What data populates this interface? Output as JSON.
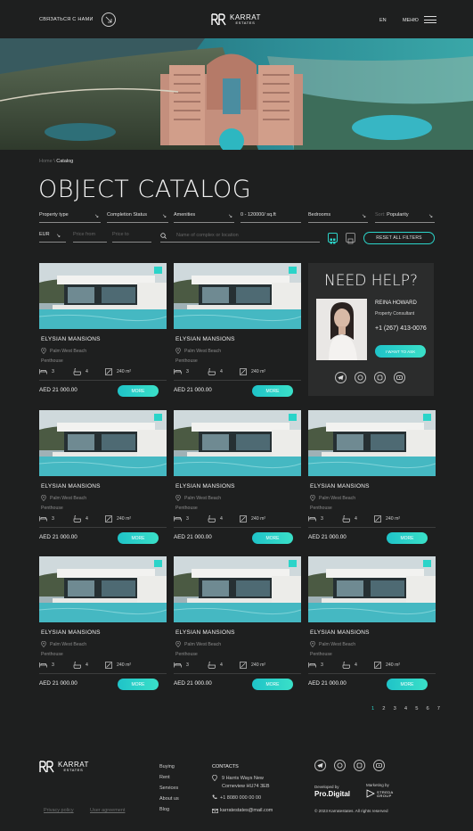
{
  "header": {
    "contact_label": "СВЯЗАТЬСЯ С НАМИ",
    "logo_line1": "KARRAT",
    "logo_line2": "ESTATES",
    "lang": "EN",
    "menu_label": "МЕНЮ"
  },
  "breadcrumb": {
    "home": "Home",
    "separator": "\\",
    "current": "Catalog"
  },
  "page_title": "OBJECT CATALOG",
  "filters": {
    "property_type": "Property type",
    "completion_status": "Completion Status",
    "amenities": "Amenities",
    "price_range": "0 - 120000/ sq.ft",
    "bedrooms": "Bedrooms",
    "sort_prefix": "Sort:",
    "sort_value": "Popularity",
    "currency": "EUR",
    "price_from_placeholder": "Price from",
    "price_to_placeholder": "Price to",
    "search_placeholder": "Name of complex or location",
    "reset_label": "RESET ALL FILTERS"
  },
  "listings": [
    {
      "name": "ELYSIAN MANSIONS",
      "location": "Palm West Beach",
      "type": "Penthouse",
      "bedrooms": "3",
      "baths": "4",
      "area": "240 m²",
      "price": "AED 21 000.00",
      "more_label": "MORE"
    },
    {
      "name": "ELYSIAN MANSIONS",
      "location": "Palm West Beach",
      "type": "Penthouse",
      "bedrooms": "3",
      "baths": "4",
      "area": "240 m²",
      "price": "AED 21 000.00",
      "more_label": "MORE"
    },
    {
      "name": "ELYSIAN MANSIONS",
      "location": "Palm West Beach",
      "type": "Penthouse",
      "bedrooms": "3",
      "baths": "4",
      "area": "240 m²",
      "price": "AED 21 000.00",
      "more_label": "MORE"
    },
    {
      "name": "ELYSIAN MANSIONS",
      "location": "Palm West Beach",
      "type": "Penthouse",
      "bedrooms": "3",
      "baths": "4",
      "area": "240 m²",
      "price": "AED 21 000.00",
      "more_label": "MORE"
    },
    {
      "name": "ELYSIAN MANSIONS",
      "location": "Palm West Beach",
      "type": "Penthouse",
      "bedrooms": "3",
      "baths": "4",
      "area": "240 m²",
      "price": "AED 21 000.00",
      "more_label": "MORE"
    },
    {
      "name": "ELYSIAN MANSIONS",
      "location": "Palm West Beach",
      "type": "Penthouse",
      "bedrooms": "3",
      "baths": "4",
      "area": "240 m²",
      "price": "AED 21 000.00",
      "more_label": "MORE"
    },
    {
      "name": "ELYSIAN MANSIONS",
      "location": "Palm West Beach",
      "type": "Penthouse",
      "bedrooms": "3",
      "baths": "4",
      "area": "240 m²",
      "price": "AED 21 000.00",
      "more_label": "MORE"
    },
    {
      "name": "ELYSIAN MANSIONS",
      "location": "Palm West Beach",
      "type": "Penthouse",
      "bedrooms": "3",
      "baths": "4",
      "area": "240 m²",
      "price": "AED 21 000.00",
      "more_label": "MORE"
    }
  ],
  "help": {
    "title": "NEED HELP?",
    "name": "REINA HOWARD",
    "role": "Property Consultant",
    "phone": "+1 (267) 413-0076",
    "ask_label": "I WANT TO ASK",
    "socials": [
      "telegram-icon",
      "whatsapp-icon",
      "viber-icon",
      "youtube-icon"
    ]
  },
  "pagination": {
    "pages": [
      "1",
      "2",
      "3",
      "4",
      "5",
      "6",
      "7"
    ],
    "current": "1"
  },
  "footer": {
    "logo_line1": "KARRAT",
    "logo_line2": "ESTATES",
    "nav": [
      "Buying",
      "Rent",
      "Services",
      "About us",
      "Blog"
    ],
    "contacts_title": "CONTACTS",
    "address_line1": "9 Harris Ways New",
    "address_line2": "Corneview HU74 3EB",
    "phone": "+1 8080 000 00 00",
    "email": "karratestates@mail.com",
    "privacy": "Privacy policy",
    "agreement": "User agreement",
    "developed_by": "Developed by",
    "developer": "Pro.Digital",
    "marketing_by": "Marketing by",
    "marketer": "STREDA GROUP",
    "copyright": "© 2023 Karratestates. All rights reserved"
  },
  "colors": {
    "background": "#1e1f1f",
    "accent": "#2bd4c9",
    "panel": "#2b2c2c"
  }
}
